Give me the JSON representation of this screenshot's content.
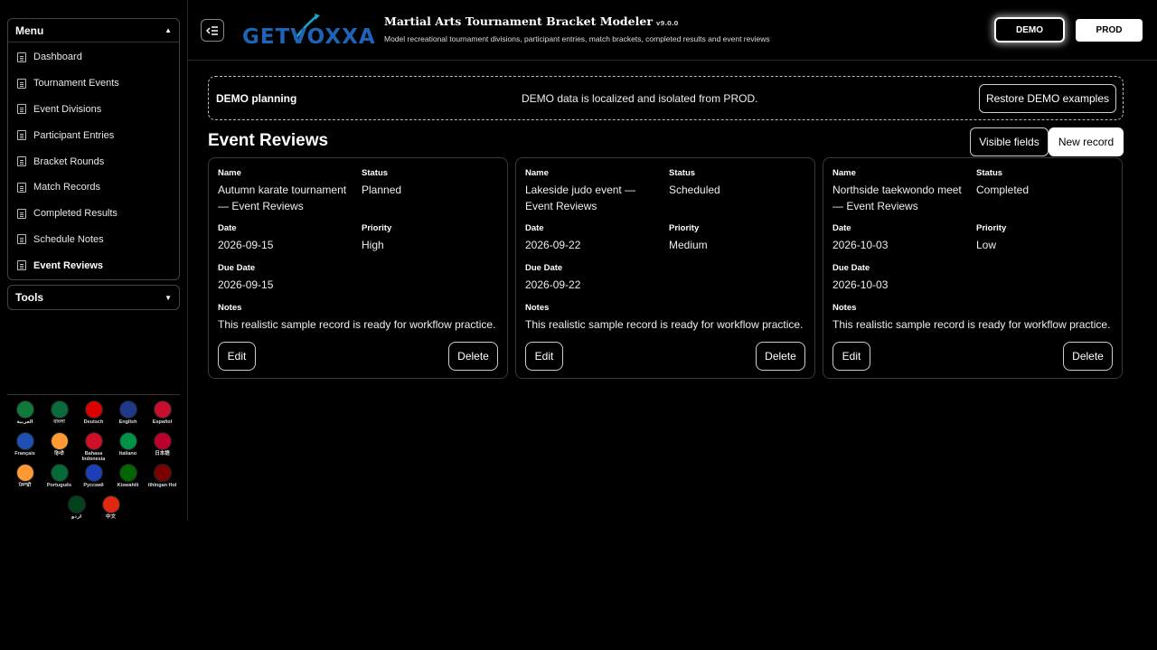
{
  "sidebar": {
    "menu_title": "Menu",
    "items": [
      {
        "label": "Dashboard"
      },
      {
        "label": "Tournament Events"
      },
      {
        "label": "Event Divisions"
      },
      {
        "label": "Participant Entries"
      },
      {
        "label": "Bracket Rounds"
      },
      {
        "label": "Match Records"
      },
      {
        "label": "Completed Results"
      },
      {
        "label": "Schedule Notes"
      },
      {
        "label": "Event Reviews"
      }
    ],
    "active_item": "Event Reviews",
    "tools_title": "Tools",
    "languages": [
      {
        "label": "العربية",
        "flag": "flag-saudi-arabia",
        "color": "#0f7a3a"
      },
      {
        "label": "বাংলা",
        "flag": "flag-bangladesh",
        "color": "#0a6b3c"
      },
      {
        "label": "Deutsch",
        "flag": "flag-germany",
        "color": "#dd0000"
      },
      {
        "label": "English",
        "flag": "flag-uk",
        "color": "#1f3a8a"
      },
      {
        "label": "Español",
        "flag": "flag-spain",
        "color": "#c8102e"
      },
      {
        "label": "Français",
        "flag": "flag-france",
        "color": "#1f4fb4"
      },
      {
        "label": "हिन्दी",
        "flag": "flag-india",
        "color": "#ff9933"
      },
      {
        "label": "Bahasa Indonesia",
        "flag": "flag-indonesia",
        "color": "#ce1126"
      },
      {
        "label": "Italiano",
        "flag": "flag-italy",
        "color": "#009246"
      },
      {
        "label": "日本語",
        "flag": "flag-japan",
        "color": "#bc002d"
      },
      {
        "label": "ਪੰਜਾਬੀ",
        "flag": "flag-india",
        "color": "#ff9933"
      },
      {
        "label": "Português",
        "flag": "flag-portugal",
        "color": "#046a38"
      },
      {
        "label": "Русский",
        "flag": "flag-russia",
        "color": "#1c3fb7"
      },
      {
        "label": "Kiswahili",
        "flag": "flag-kenya",
        "color": "#006600"
      },
      {
        "label": "tlhIngan Hol",
        "flag": "flag-klingon",
        "color": "#7a0000"
      },
      {
        "label": "اردو",
        "flag": "flag-pakistan",
        "color": "#01411c"
      },
      {
        "label": "中文",
        "flag": "flag-china",
        "color": "#de2910"
      }
    ]
  },
  "header": {
    "logo_text": "GETVOXXA",
    "title": "Martial Arts Tournament Bracket Modeler",
    "version": "v9.0.0",
    "subtitle": "Model recreational tournament divisions, participant entries, match brackets, completed results and event reviews",
    "env_demo": "DEMO",
    "env_prod": "PROD"
  },
  "banner": {
    "title": "DEMO planning",
    "message": "DEMO data is localized and isolated from PROD.",
    "restore_label": "Restore DEMO examples"
  },
  "section": {
    "title": "Event Reviews",
    "visible_fields_label": "Visible fields",
    "new_record_label": "New record"
  },
  "labels": {
    "name": "Name",
    "status": "Status",
    "date": "Date",
    "priority": "Priority",
    "due_date": "Due Date",
    "notes": "Notes",
    "edit": "Edit",
    "delete": "Delete"
  },
  "records": [
    {
      "name_line1": "Autumn karate tournament",
      "name_line2": "— Event Reviews",
      "status": "Planned",
      "date": "2026-09-15",
      "priority": "High",
      "due_date": "2026-09-15",
      "notes": "This realistic sample record is ready for workflow practice."
    },
    {
      "name_line1": "Lakeside judo event —",
      "name_line2": "Event Reviews",
      "status": "Scheduled",
      "date": "2026-09-22",
      "priority": "Medium",
      "due_date": "2026-09-22",
      "notes": "This realistic sample record is ready for workflow practice."
    },
    {
      "name_line1": "Northside taekwondo meet",
      "name_line2": "— Event Reviews",
      "status": "Completed",
      "date": "2026-10-03",
      "priority": "Low",
      "due_date": "2026-10-03",
      "notes": "This realistic sample record is ready for workflow practice."
    }
  ]
}
